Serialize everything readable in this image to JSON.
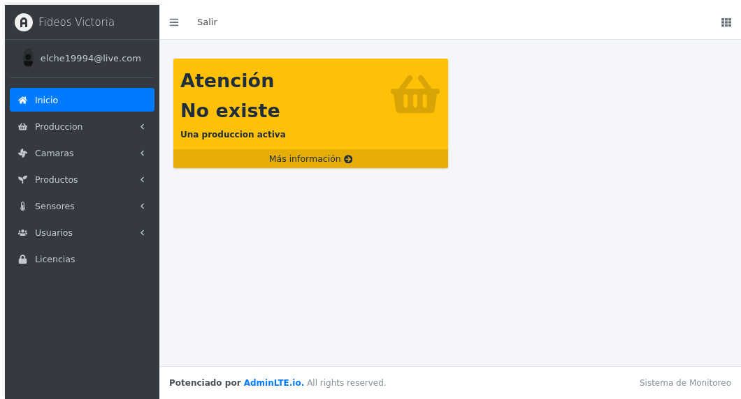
{
  "brand": {
    "name": "Fideos Victoria"
  },
  "user": {
    "email": "elche19994@live.com"
  },
  "sidebar": {
    "items": [
      {
        "label": "Inicio",
        "selected": true,
        "expandable": false
      },
      {
        "label": "Produccion",
        "selected": false,
        "expandable": true
      },
      {
        "label": "Camaras",
        "selected": false,
        "expandable": true
      },
      {
        "label": "Productos",
        "selected": false,
        "expandable": true
      },
      {
        "label": "Sensores",
        "selected": false,
        "expandable": true
      },
      {
        "label": "Usuarios",
        "selected": false,
        "expandable": true
      },
      {
        "label": "Licencias",
        "selected": false,
        "expandable": false
      }
    ]
  },
  "navbar": {
    "link": "Salir"
  },
  "card": {
    "title": "Atención",
    "subtitle": "No existe",
    "text": "Una produccion activa",
    "footer": "Más información"
  },
  "footer": {
    "prefix": "Potenciado por",
    "link": "AdminLTE.io.",
    "suffix": "All rights reserved.",
    "right": "Sistema de Monitoreo"
  }
}
